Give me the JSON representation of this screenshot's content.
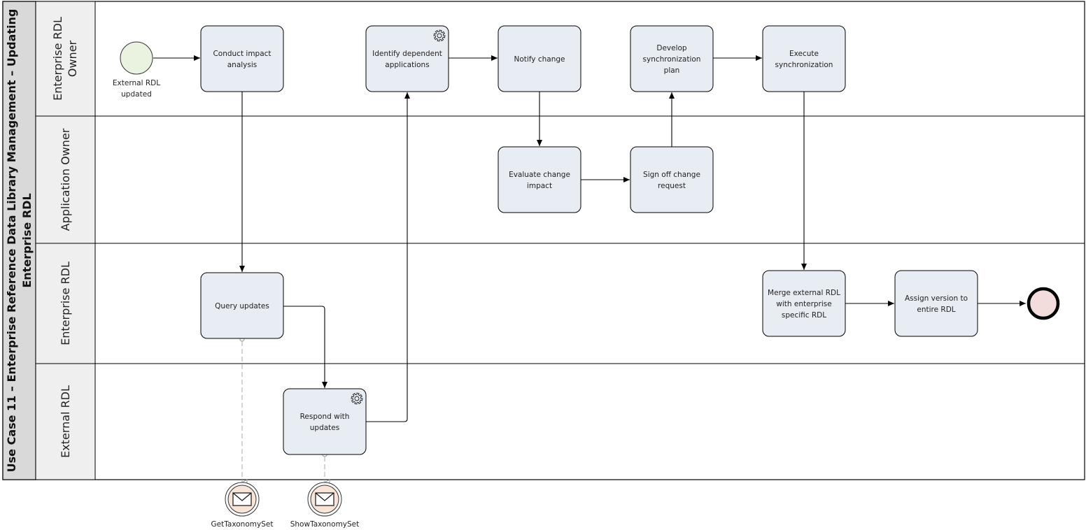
{
  "pool": {
    "title_line1": "Use Case 11 – Enterprise Reference Data Library Management – Updating",
    "title_line2": "Enterprise RDL"
  },
  "lanes": [
    {
      "id": "erdl-owner",
      "label_line1": "Enterprise RDL",
      "label_line2": "Owner"
    },
    {
      "id": "app-owner",
      "label_line1": "Application Owner",
      "label_line2": ""
    },
    {
      "id": "erdl",
      "label_line1": "Enterprise RDL",
      "label_line2": ""
    },
    {
      "id": "ext-rdl",
      "label_line1": "External RDL",
      "label_line2": ""
    }
  ],
  "start_event": {
    "label_line1": "External RDL",
    "label_line2": "updated"
  },
  "tasks": [
    {
      "id": "conduct",
      "lines": [
        "Conduct impact",
        "analysis"
      ],
      "service": false
    },
    {
      "id": "identify",
      "lines": [
        "Identify dependent",
        "applications"
      ],
      "service": true
    },
    {
      "id": "notify",
      "lines": [
        "Notify change"
      ],
      "service": false
    },
    {
      "id": "develop",
      "lines": [
        "Develop",
        "synchronization",
        "plan"
      ],
      "service": false
    },
    {
      "id": "execute",
      "lines": [
        "Execute",
        "synchronization"
      ],
      "service": false
    },
    {
      "id": "evaluate",
      "lines": [
        "Evaluate change",
        "impact"
      ],
      "service": false
    },
    {
      "id": "signoff",
      "lines": [
        "Sign off change",
        "request"
      ],
      "service": false
    },
    {
      "id": "query",
      "lines": [
        "Query updates"
      ],
      "service": false
    },
    {
      "id": "respond",
      "lines": [
        "Respond with",
        "updates"
      ],
      "service": true
    },
    {
      "id": "merge",
      "lines": [
        "Merge external RDL",
        "with enterprise",
        "specific RDL"
      ],
      "service": false
    },
    {
      "id": "assign",
      "lines": [
        "Assign version to",
        "entire RDL"
      ],
      "service": false
    }
  ],
  "messages": [
    {
      "id": "get",
      "label": "GetTaxonomySet"
    },
    {
      "id": "show",
      "label": "ShowTaxonomySet"
    }
  ],
  "colors": {
    "task_fill": "#e8ecf3",
    "start_fill": "#eaf2e0",
    "end_fill": "#f2dcdc",
    "message_fill": "#f9e4d8",
    "pool_header": "#d9d9d9",
    "lane_header": "#efefef"
  }
}
